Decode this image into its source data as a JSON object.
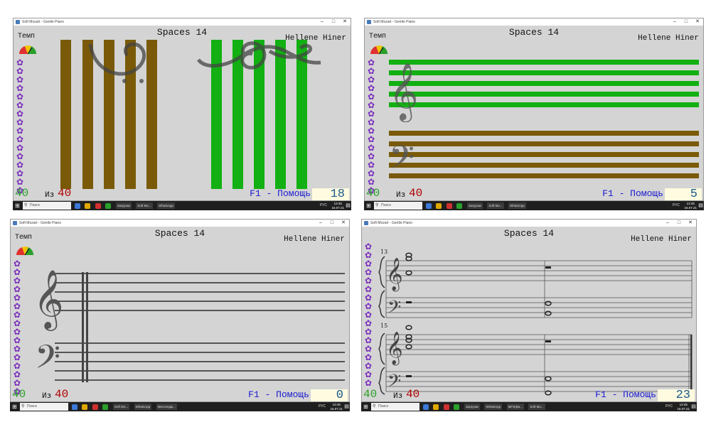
{
  "colors": {
    "window_bg": "#d4d4d4",
    "brown_bar": "#7a5a08",
    "green_bar": "#12b012",
    "flower": "#7a2fbd",
    "green_num": "#2aa02a",
    "red_num": "#b00000",
    "help_blue": "#1a1ad0",
    "count_bg": "#fffbe0"
  },
  "panels": [
    {
      "window_title": "Soft Mozart - Gentle Piano",
      "song_title": "Spaces 14",
      "composer": "Hellene Hiner",
      "tempo_label": "Темп",
      "current_number": "40",
      "of_label": "Из",
      "total_number": "40",
      "help_text": "F1 - Помощь",
      "counter": "18",
      "view": "vertical-bars"
    },
    {
      "window_title": "Soft Mozart - Gentle Piano",
      "song_title": "Spaces 14",
      "composer": "Hellene Hiner",
      "tempo_label": "Темп",
      "current_number": "40",
      "of_label": "Из",
      "total_number": "40",
      "help_text": "F1 - Помощь",
      "counter": "5",
      "view": "horizontal-bars"
    },
    {
      "window_title": "Soft Mozart - Gentle Piano",
      "song_title": "Spaces 14",
      "composer": "Hellene Hiner",
      "tempo_label": "Темп",
      "current_number": "40",
      "of_label": "Из",
      "total_number": "40",
      "help_text": "F1 - Помощь",
      "counter": "0",
      "view": "staff-empty"
    },
    {
      "window_title": "Soft Mozart - Gentle Piano",
      "song_title": "Spaces 14",
      "composer": "Hellene Hiner",
      "tempo_label": "",
      "current_number": "40",
      "of_label": "Из",
      "total_number": "40",
      "help_text": "F1 - Помощь",
      "counter": "23",
      "view": "staff-notes",
      "measure_numbers": [
        "13",
        "15"
      ]
    }
  ],
  "taskbar": {
    "search_placeholder": "Поиск",
    "apps": [
      "Загрузки",
      "Soft Mo...",
      "WhatsApp",
      "Мессендж...",
      "MFS(Ва...",
      "Soft Mo..."
    ],
    "tray_lang": "РУС",
    "clock_time": "13:45",
    "clock_date": "16.07.21"
  },
  "icons": {
    "start": "windows-start-icon",
    "search": "magnifier-icon",
    "flower": "flower-icon",
    "close": "close-icon",
    "minimize": "minimize-icon",
    "maximize": "maximize-icon"
  }
}
